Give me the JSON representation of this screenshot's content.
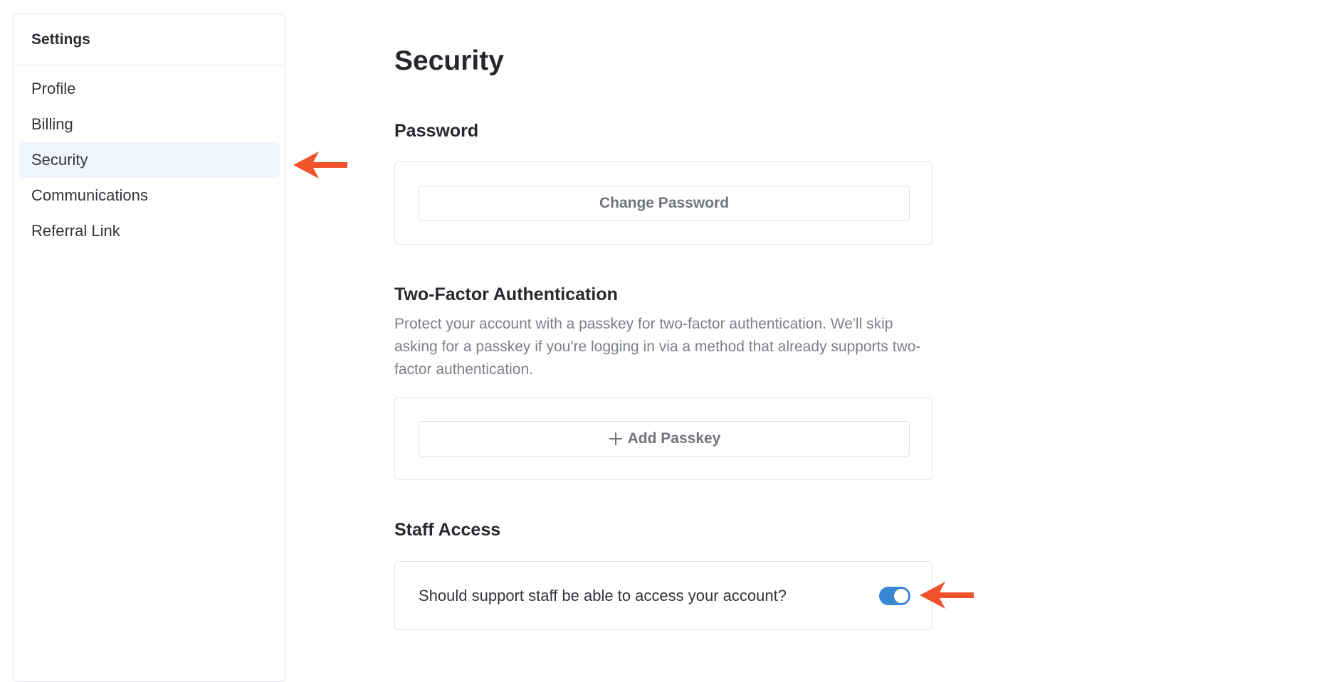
{
  "colors": {
    "accent": "#3b87d6",
    "annotation_arrow": "#f0532b",
    "active_item_bg": "#eff6fd"
  },
  "sidebar": {
    "title": "Settings",
    "items": [
      {
        "label": "Profile",
        "active": false
      },
      {
        "label": "Billing",
        "active": false
      },
      {
        "label": "Security",
        "active": true
      },
      {
        "label": "Communications",
        "active": false
      },
      {
        "label": "Referral Link",
        "active": false
      }
    ]
  },
  "main": {
    "title": "Security",
    "password": {
      "title": "Password",
      "button_label": "Change Password"
    },
    "two_factor": {
      "title": "Two-Factor Authentication",
      "description": "Protect your account with a passkey for two-factor authentication. We'll skip asking for a passkey if you're logging in via a method that already supports two-factor authentication.",
      "button_icon": "plus-icon",
      "button_label": "Add Passkey"
    },
    "staff_access": {
      "title": "Staff Access",
      "question": "Should support staff be able to access your account?",
      "enabled": true
    }
  }
}
